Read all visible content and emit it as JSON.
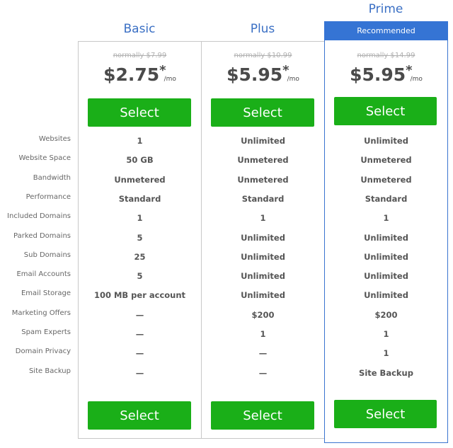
{
  "features": [
    "Websites",
    "Website Space",
    "Bandwidth",
    "Performance",
    "Included Domains",
    "Parked Domains",
    "Sub Domains",
    "Email Accounts",
    "Email Storage",
    "Marketing Offers",
    "Spam Experts",
    "Domain Privacy",
    "Site Backup"
  ],
  "plans": [
    {
      "name": "Basic",
      "normally": "normally $7.99",
      "price": "$2.75",
      "asterisk": "*",
      "per": "/mo",
      "select_label": "Select",
      "values": [
        "1",
        "50 GB",
        "Unmetered",
        "Standard",
        "1",
        "5",
        "25",
        "5",
        "100 MB per account",
        "—",
        "—",
        "—",
        "—"
      ]
    },
    {
      "name": "Plus",
      "normally": "normally $10.99",
      "price": "$5.95",
      "asterisk": "*",
      "per": "/mo",
      "select_label": "Select",
      "values": [
        "Unlimited",
        "Unmetered",
        "Unmetered",
        "Standard",
        "1",
        "Unlimited",
        "Unlimited",
        "Unlimited",
        "Unlimited",
        "$200",
        "1",
        "—",
        "—"
      ]
    },
    {
      "name": "Prime",
      "badge": "Recommended",
      "normally": "normally $14.99",
      "price": "$5.95",
      "asterisk": "*",
      "per": "/mo",
      "select_label": "Select",
      "values": [
        "Unlimited",
        "Unmetered",
        "Unmetered",
        "Standard",
        "1",
        "Unlimited",
        "Unlimited",
        "Unlimited",
        "Unlimited",
        "$200",
        "1",
        "1",
        "Site Backup"
      ]
    }
  ],
  "colors": {
    "accent": "#3574d4",
    "button": "#1aaf18",
    "title": "#3a6fc4"
  }
}
